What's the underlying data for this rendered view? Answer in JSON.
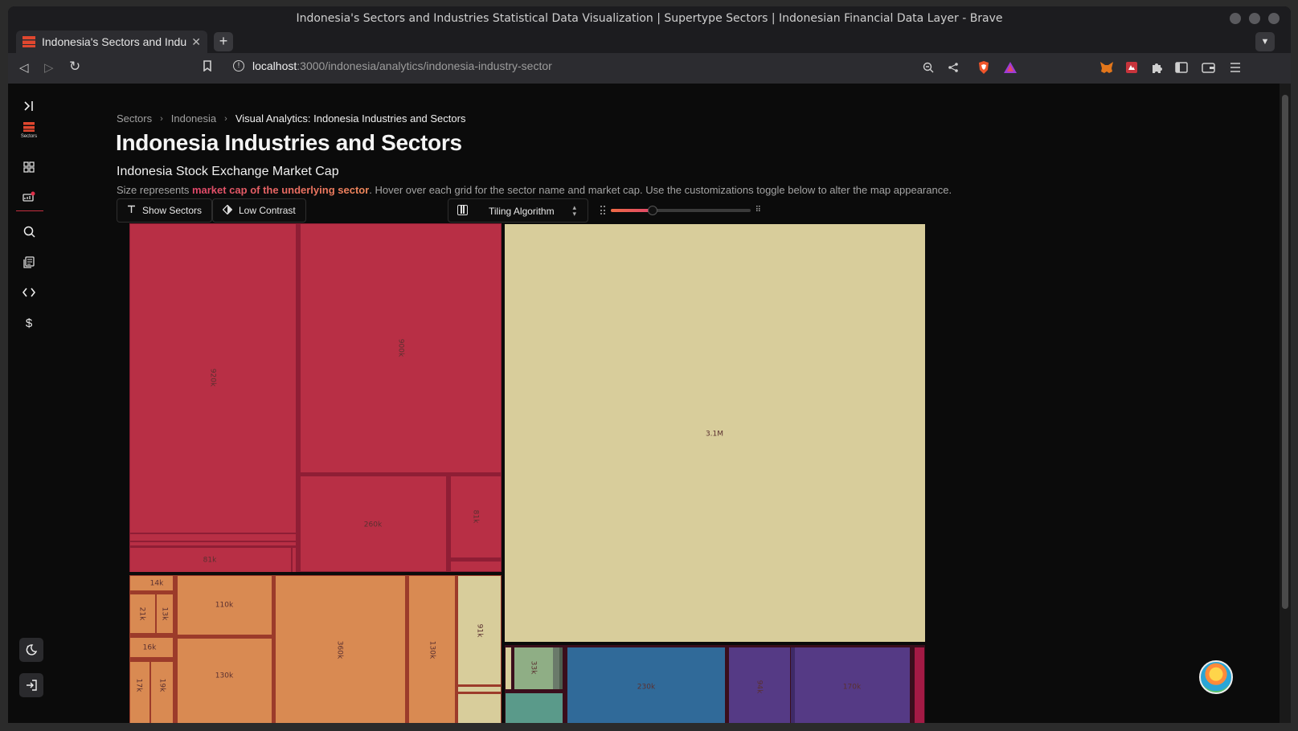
{
  "browser": {
    "window_title": "Indonesia's Sectors and Industries Statistical Data Visualization | Supertype Sectors | Indonesian Financial Data Layer - Brave",
    "tab_title": "Indonesia's Sectors and Industries",
    "url_host": "localhost",
    "url_path": ":3000/indonesia/analytics/indonesia-industry-sector"
  },
  "sidebar": {
    "logo_label": "Sectors"
  },
  "breadcrumb": {
    "items": [
      "Sectors",
      "Indonesia",
      "Visual Analytics: Indonesia Industries and Sectors"
    ]
  },
  "header": {
    "title": "Indonesia Industries and Sectors",
    "subtitle": "Indonesia Stock Exchange Market Cap",
    "desc_prefix": "Size represents ",
    "desc_highlight": "market cap of the underlying sector",
    "desc_suffix": ". Hover over each grid for the sector name and market cap. Use the customizations toggle below to alter the map appearance."
  },
  "controls": {
    "show_sectors_label": "Show Sectors",
    "low_contrast_label": "Low Contrast",
    "tiling_label": "Tiling Algorithm",
    "slider_value": 0.3
  },
  "colors": {
    "red": "#b82f45",
    "orange": "#d98a52",
    "cream": "#d8cd9b",
    "blue": "#306a99",
    "purple": "#553a85",
    "green": "#8fae85"
  },
  "chart_data": {
    "type": "treemap",
    "values": [
      "920k",
      "900k",
      "260k",
      "81k",
      "81k",
      "3.1M",
      "14k",
      "21k",
      "13k",
      "16k",
      "17k",
      "19k",
      "110k",
      "130k",
      "360k",
      "130k",
      "91k",
      "33k",
      "230k",
      "94k",
      "170k"
    ]
  }
}
